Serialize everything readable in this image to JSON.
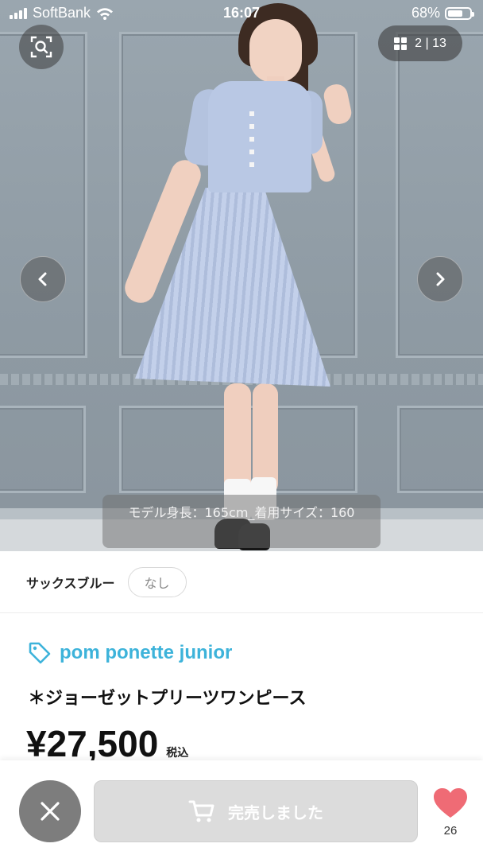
{
  "status_bar": {
    "carrier": "SoftBank",
    "time": "16:07",
    "battery_percent": "68%",
    "battery_level": 0.68
  },
  "gallery": {
    "counter": "2 | 13",
    "current_index": 2,
    "total": 13,
    "caption": "モデル身長：165cm_着用サイズ：160"
  },
  "color_selector": {
    "color_name": "サックスブルー",
    "chip_label": "なし"
  },
  "product": {
    "brand": "pom ponette junior",
    "title": "＊ジョーゼットプリーツワンピース",
    "price": "¥27,500",
    "tax_label": "税込"
  },
  "bottom_bar": {
    "sold_out_label": "完売しました",
    "favorite_count": "26"
  },
  "colors": {
    "brand_accent": "#3db3da",
    "heart": "#ef6b75",
    "disabled_button": "#dcdcdc"
  },
  "icons": {
    "lens": "image-search-icon",
    "grid": "grid-icon",
    "prev": "chevron-left-icon",
    "next": "chevron-right-icon",
    "tag": "tag-icon",
    "close": "close-icon",
    "cart": "cart-icon",
    "heart": "heart-icon"
  }
}
